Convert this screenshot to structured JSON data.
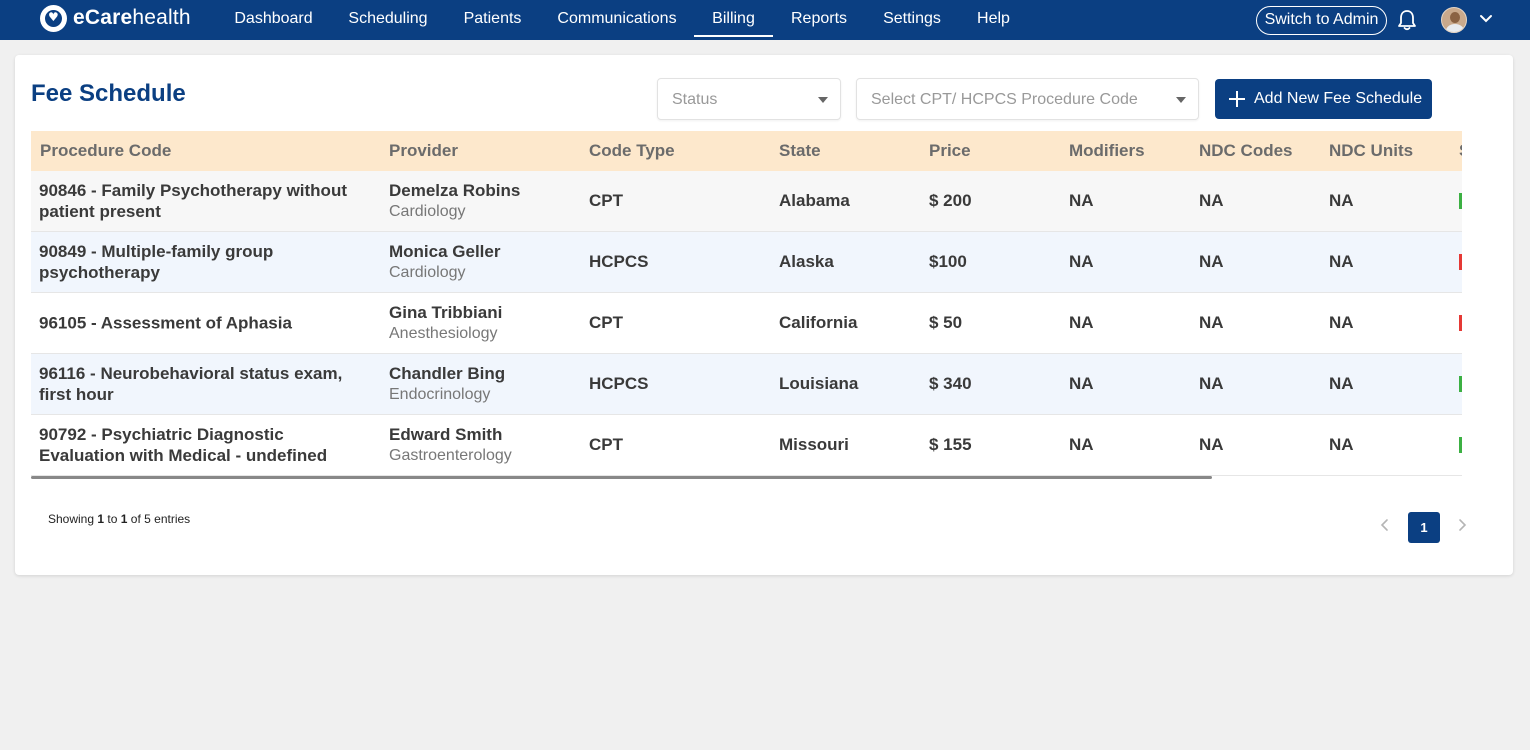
{
  "brand": {
    "bold": "eCare",
    "light": "health"
  },
  "nav": {
    "items": [
      {
        "label": "Dashboard"
      },
      {
        "label": "Scheduling"
      },
      {
        "label": "Patients"
      },
      {
        "label": "Communications"
      },
      {
        "label": "Billing",
        "active": true
      },
      {
        "label": "Reports"
      },
      {
        "label": "Settings"
      },
      {
        "label": "Help"
      }
    ],
    "switch_label": "Switch to Admin"
  },
  "page": {
    "title": "Fee Schedule",
    "status_placeholder": "Status",
    "code_placeholder": "Select CPT/ HCPCS Procedure Code",
    "add_label": "Add New Fee Schedule"
  },
  "table": {
    "columns": [
      "Procedure Code",
      "Provider",
      "Code Type",
      "State",
      "Price",
      "Modifiers",
      "NDC Codes",
      "NDC Units",
      "S"
    ],
    "rows": [
      {
        "procedure": "90846 - Family Psychotherapy without patient present",
        "provider": "Demelza Robins",
        "specialty": "Cardiology",
        "code_type": "CPT",
        "state": "Alabama",
        "price": "$ 200",
        "modifiers": "NA",
        "ndc_codes": "NA",
        "ndc_units": "NA",
        "status_color": "#3cb043"
      },
      {
        "procedure": "90849 - Multiple-family group psychotherapy",
        "provider": "Monica Geller",
        "specialty": "Cardiology",
        "code_type": "HCPCS",
        "state": "Alaska",
        "price": "$100",
        "modifiers": "NA",
        "ndc_codes": "NA",
        "ndc_units": "NA",
        "status_color": "#e53935"
      },
      {
        "procedure": "96105 - Assessment of Aphasia",
        "provider": "Gina Tribbiani",
        "specialty": "Anesthesiology",
        "code_type": "CPT",
        "state": "California",
        "price": "$ 50",
        "modifiers": "NA",
        "ndc_codes": "NA",
        "ndc_units": "NA",
        "status_color": "#e53935"
      },
      {
        "procedure": "96116 - Neurobehavioral status exam, first hour",
        "provider": "Chandler Bing",
        "specialty": "Endocrinology",
        "code_type": "HCPCS",
        "state": "Louisiana",
        "price": "$ 340",
        "modifiers": "NA",
        "ndc_codes": "NA",
        "ndc_units": "NA",
        "status_color": "#3cb043"
      },
      {
        "procedure": "90792 - Psychiatric Diagnostic Evaluation with Medical - undefined",
        "provider": "Edward Smith",
        "specialty": "Gastroenterology",
        "code_type": "CPT",
        "state": "Missouri",
        "price": "$ 155",
        "modifiers": "NA",
        "ndc_codes": "NA",
        "ndc_units": "NA",
        "status_color": "#3cb043"
      }
    ]
  },
  "pagination": {
    "showing_prefix": "Showing",
    "from": "1",
    "to_word": "to",
    "to": "1",
    "of_text": "of 5 entries",
    "current_page": "1"
  },
  "colors": {
    "brand": "#0b3f82",
    "header_bg": "#fde8cc"
  }
}
